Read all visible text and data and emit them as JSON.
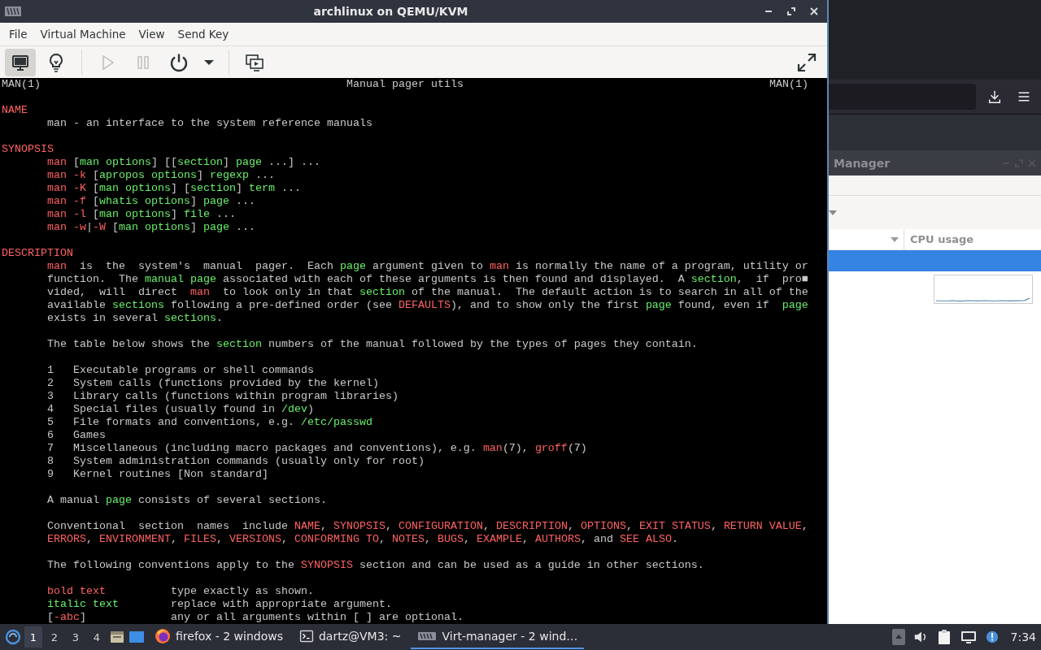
{
  "vm_window": {
    "title": "archlinux on QEMU/KVM",
    "menu": [
      {
        "label": "File"
      },
      {
        "label": "Virtual Machine"
      },
      {
        "label": "View"
      },
      {
        "label": "Send Key"
      }
    ],
    "toolbar": {
      "groups": [
        [
          {
            "kind": "display",
            "selected": true,
            "disabled": false
          },
          {
            "kind": "bulb",
            "selected": false,
            "disabled": false
          }
        ],
        [
          {
            "kind": "play",
            "selected": false,
            "disabled": true
          },
          {
            "kind": "pause",
            "selected": false,
            "disabled": true
          },
          {
            "kind": "power",
            "selected": false,
            "disabled": false
          },
          {
            "kind": "dropdown",
            "selected": false,
            "disabled": false
          }
        ],
        [
          {
            "kind": "screens",
            "selected": false,
            "disabled": false
          }
        ]
      ],
      "right": [
        {
          "kind": "fullscreen",
          "selected": false,
          "disabled": false
        }
      ]
    },
    "console": {
      "header": {
        "left": "MAN(1)",
        "center": "Manual pager utils",
        "right": "MAN(1)"
      },
      "blocks": [
        [
          "**NAME**",
          "       man - an interface to the system reference manuals"
        ],
        [
          "**SYNOPSIS**",
          "       **man** [*man options*] [[*section*] *page* ...] ...",
          "       **man -k** [*apropos options*] *regexp* ...",
          "       **man -K** [*man options*] [*section*] *term* ...",
          "       **man -f** [*whatis options*] *page* ...",
          "       **man -l** [*man options*] *file* ...",
          "       **man -w**|**-W** [*man options*] *page* ..."
        ],
        [
          "**DESCRIPTION**",
          "       **man**  is  the  system's  manual  pager.  Each *page* argument given to **man** is normally the name of a program, utility or",
          "       function.  The *manual page* associated with each of these arguments is then found and displayed.  A *section*,  if  pro■",
          "       vided,  will  direct  **man**  to look only in that *section* of the manual.  The default action is to search in all of the",
          "       available *sections* following a pre-defined order (see **DEFAULTS**), and to show only the first *page* found, even if  *page*",
          "       exists in several *sections*."
        ],
        [
          "       The table below shows the *section* numbers of the manual followed by the types of pages they contain."
        ],
        [
          "       1   Executable programs or shell commands",
          "       2   System calls (functions provided by the kernel)",
          "       3   Library calls (functions within program libraries)",
          "       4   Special files (usually found in */dev*)",
          "       5   File formats and conventions, e.g. */etc/passwd*",
          "       6   Games",
          "       7   Miscellaneous (including macro packages and conventions), e.g. **man**(7), **groff**(7)",
          "       8   System administration commands (usually only for root)",
          "       9   Kernel routines [Non standard]"
        ],
        [
          "       A manual *page* consists of several sections."
        ],
        [
          "       Conventional  section  names  include **NAME**, **SYNOPSIS**, **CONFIGURATION**, **DESCRIPTION**, **OPTIONS**, **EXIT STATUS**, **RETURN VALUE**,",
          "       **ERRORS**, **ENVIRONMENT**, **FILES**, **VERSIONS**, **CONFORMING TO**, **NOTES**, **BUGS**, **EXAMPLE**, **AUTHORS**, and **SEE ALSO**."
        ],
        [
          "       The following conventions apply to the **SYNOPSIS** section and can be used as a guide in other sections."
        ],
        [
          "       **bold text**          type exactly as shown.",
          "       *italic text*        replace with appropriate argument.",
          "       [**-abc**]             any or all arguments within [ ] are optional."
        ]
      ]
    }
  },
  "manager_window": {
    "title": "Manager",
    "columns": [
      {
        "label": "CPU usage"
      }
    ],
    "rows": [
      {
        "selected": true
      },
      {
        "selected": false
      }
    ]
  },
  "taskbar": {
    "workspaces": [
      {
        "label": "1",
        "selected": true
      },
      {
        "label": "2",
        "selected": false
      },
      {
        "label": "3",
        "selected": false
      },
      {
        "label": "4",
        "selected": false
      }
    ],
    "tasks": [
      {
        "kind": "firefox",
        "label": "firefox - 2 windows",
        "selected": false
      },
      {
        "kind": "terminal",
        "label": "dartz@VM3: ~",
        "selected": false
      },
      {
        "kind": "virt",
        "label": "Virt-manager - 2 wind…",
        "selected": true
      }
    ],
    "clock": "7:34"
  }
}
